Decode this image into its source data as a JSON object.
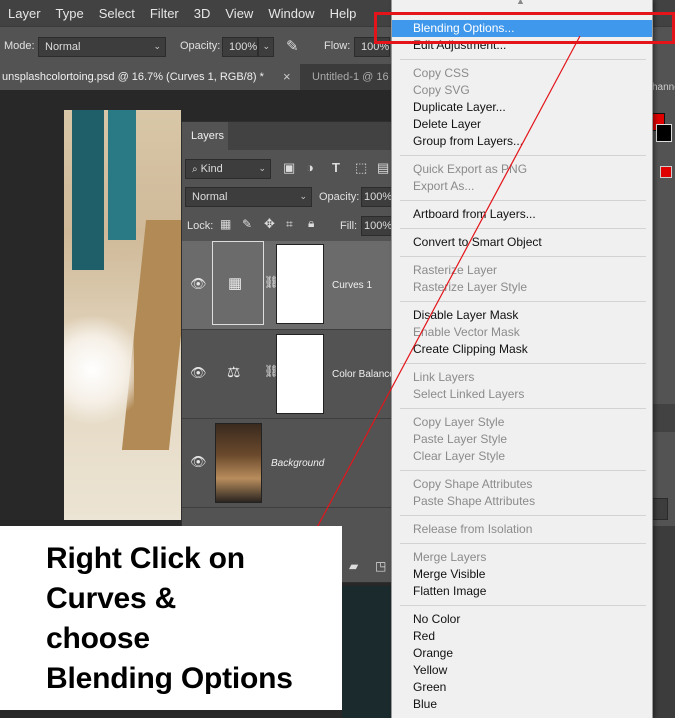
{
  "menubar": {
    "items": [
      "Layer",
      "Type",
      "Select",
      "Filter",
      "3D",
      "View",
      "Window",
      "Help"
    ]
  },
  "options": {
    "mode_label": "Mode:",
    "mode_value": "Normal",
    "opacity_label": "Opacity:",
    "opacity_value": "100%",
    "flow_label": "Flow:",
    "flow_value": "100%"
  },
  "doc_tabs": {
    "active": "unsplashcolortoing.psd @ 16.7% (Curves 1, RGB/8) *",
    "close": "×",
    "inactive": "Untitled-1 @ 16",
    "right_panel_title": "hanne"
  },
  "layers_panel": {
    "title": "Layers",
    "filter_kind": "Kind",
    "blend_mode": "Normal",
    "opacity_label": "Opacity:",
    "opacity_value": "100%",
    "lock_label": "Lock:",
    "fill_label": "Fill:",
    "fill_value": "100%",
    "layers": [
      {
        "name": "Curves 1"
      },
      {
        "name": "Color Balance"
      },
      {
        "name": "Background"
      }
    ]
  },
  "context_menu": {
    "items": [
      {
        "label": "Blending Options...",
        "state": "highlighted"
      },
      {
        "label": "Edit Adjustment...",
        "state": "enabled"
      },
      {
        "label": "Copy CSS",
        "state": "disabled"
      },
      {
        "label": "Copy SVG",
        "state": "disabled"
      },
      {
        "label": "Duplicate Layer...",
        "state": "enabled"
      },
      {
        "label": "Delete Layer",
        "state": "enabled"
      },
      {
        "label": "Group from Layers...",
        "state": "enabled"
      },
      {
        "label": "Quick Export as PNG",
        "state": "disabled"
      },
      {
        "label": "Export As...",
        "state": "disabled"
      },
      {
        "label": "Artboard from Layers...",
        "state": "enabled"
      },
      {
        "label": "Convert to Smart Object",
        "state": "enabled"
      },
      {
        "label": "Rasterize Layer",
        "state": "disabled"
      },
      {
        "label": "Rasterize Layer Style",
        "state": "disabled"
      },
      {
        "label": "Disable Layer Mask",
        "state": "enabled"
      },
      {
        "label": "Enable Vector Mask",
        "state": "disabled"
      },
      {
        "label": "Create Clipping Mask",
        "state": "enabled"
      },
      {
        "label": "Link Layers",
        "state": "disabled"
      },
      {
        "label": "Select Linked Layers",
        "state": "disabled"
      },
      {
        "label": "Copy Layer Style",
        "state": "disabled"
      },
      {
        "label": "Paste Layer Style",
        "state": "disabled"
      },
      {
        "label": "Clear Layer Style",
        "state": "disabled"
      },
      {
        "label": "Copy Shape Attributes",
        "state": "disabled"
      },
      {
        "label": "Paste Shape Attributes",
        "state": "disabled"
      },
      {
        "label": "Release from Isolation",
        "state": "disabled"
      },
      {
        "label": "Merge Layers",
        "state": "disabled"
      },
      {
        "label": "Merge Visible",
        "state": "enabled"
      },
      {
        "label": "Flatten Image",
        "state": "enabled"
      },
      {
        "label": "No Color",
        "state": "enabled"
      },
      {
        "label": "Red",
        "state": "enabled"
      },
      {
        "label": "Orange",
        "state": "enabled"
      },
      {
        "label": "Yellow",
        "state": "enabled"
      },
      {
        "label": "Green",
        "state": "enabled"
      },
      {
        "label": "Blue",
        "state": "enabled"
      }
    ]
  },
  "annotation": {
    "lines": [
      "Right Click on",
      "Curves &",
      "choose",
      "Blending Options"
    ]
  },
  "colors": {
    "accent_highlight": "#3f98ec",
    "annotation_red": "#e3151a",
    "foreground_swatch": "#e00000"
  }
}
